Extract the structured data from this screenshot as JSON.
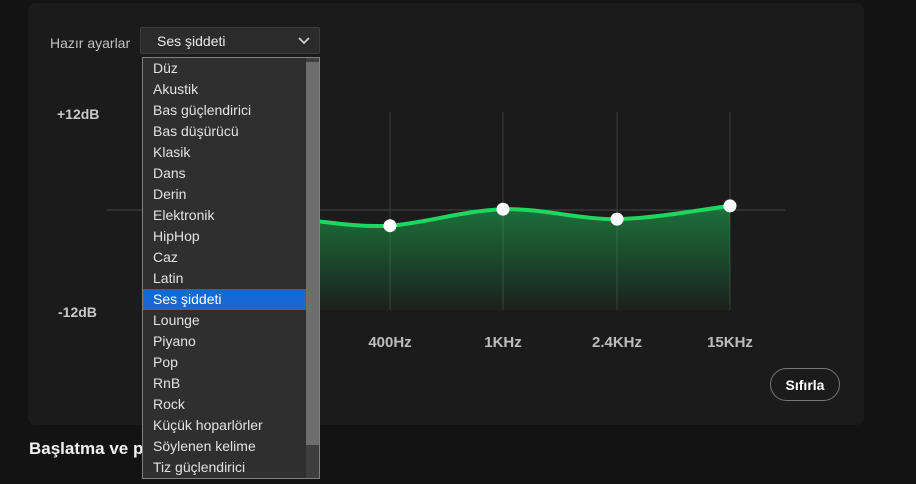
{
  "page": {
    "background": "#131313",
    "card_background": "#1b1b1b"
  },
  "preset_row": {
    "label": "Hazır ayarlar"
  },
  "preset_dropdown": {
    "value": "Ses şiddeti",
    "selected_option": "Ses şiddeti",
    "selected_index": 11,
    "highlight_color": "#1668d3",
    "options": [
      "Düz",
      "Akustik",
      "Bas güçlendirici",
      "Bas düşürücü",
      "Klasik",
      "Dans",
      "Derin",
      "Elektronik",
      "HipHop",
      "Caz",
      "Latin",
      "Ses şiddeti",
      "Lounge",
      "Piyano",
      "Pop",
      "RnB",
      "Rock",
      "Küçük hoparlörler",
      "Söylenen kelime",
      "Tiz güçlendirici"
    ]
  },
  "chart_data": {
    "type": "line",
    "ylabel": "dB",
    "ylim": [
      -12,
      12
    ],
    "axis_top_label": "+12dB",
    "axis_bottom_label": "-12dB",
    "accent_color": "#1ed760",
    "fill_color": "#1db954",
    "grid": true,
    "bands": [
      {
        "label": "400Hz",
        "db": -1.9
      },
      {
        "label": "1KHz",
        "db": 0.1
      },
      {
        "label": "2.4KHz",
        "db": -1.1
      },
      {
        "label": "15KHz",
        "db": 0.5
      }
    ],
    "curve_entry_db": -1.3
  },
  "equalizer": {
    "reset_button": "Sıfırla"
  },
  "next_section": {
    "heading_visible": "Başlatma ve p"
  }
}
